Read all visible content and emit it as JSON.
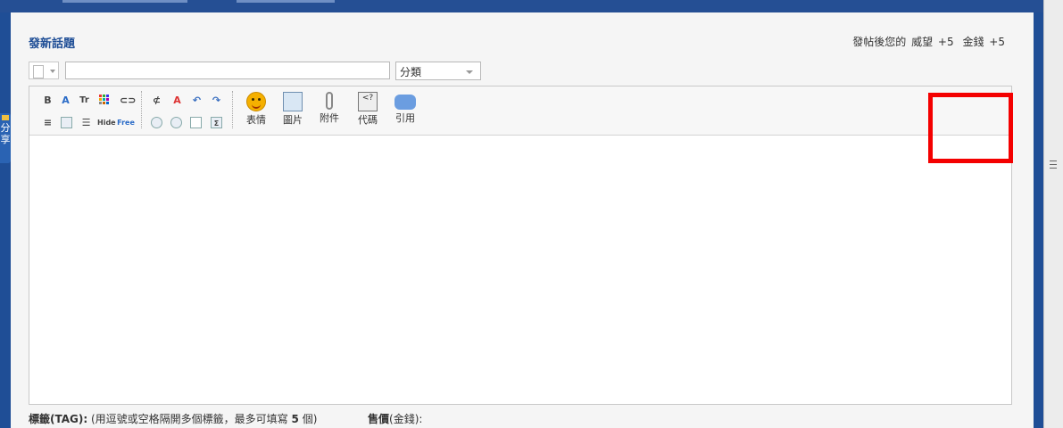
{
  "page": {
    "title": "發新話題",
    "reward_prefix": "發帖後您的",
    "reward_1_label": "威望",
    "reward_1_value": "+5",
    "reward_2_label": "金錢",
    "reward_2_value": "+5",
    "share_tab": "分享"
  },
  "form": {
    "category_selected": "分類",
    "subject_value": ""
  },
  "toolbar": {
    "row1": [
      "B",
      "A",
      "Tr",
      "color",
      "link",
      "unlink",
      "clear-format",
      "undo",
      "redo"
    ],
    "row2": [
      "align",
      "float",
      "list",
      "Hide",
      "Free",
      "media",
      "flash",
      "page",
      "index"
    ],
    "big": [
      {
        "label": "表情",
        "icon": "smiley-icon"
      },
      {
        "label": "圖片",
        "icon": "image-icon"
      },
      {
        "label": "附件",
        "icon": "paperclip-icon"
      },
      {
        "label": "代碼",
        "icon": "code-icon"
      },
      {
        "label": "引用",
        "icon": "quote-icon"
      }
    ]
  },
  "footer": {
    "tag_label": "標籤(TAG):",
    "tag_hint_a": "(用逗號或空格隔開多個標籤，最多可填寫",
    "tag_hint_num": "5",
    "tag_hint_b": "個)",
    "price_label": "售價",
    "price_hint": "(金錢):"
  },
  "colors": {
    "accent": "#1f4e96",
    "highlight": "#f40000"
  }
}
